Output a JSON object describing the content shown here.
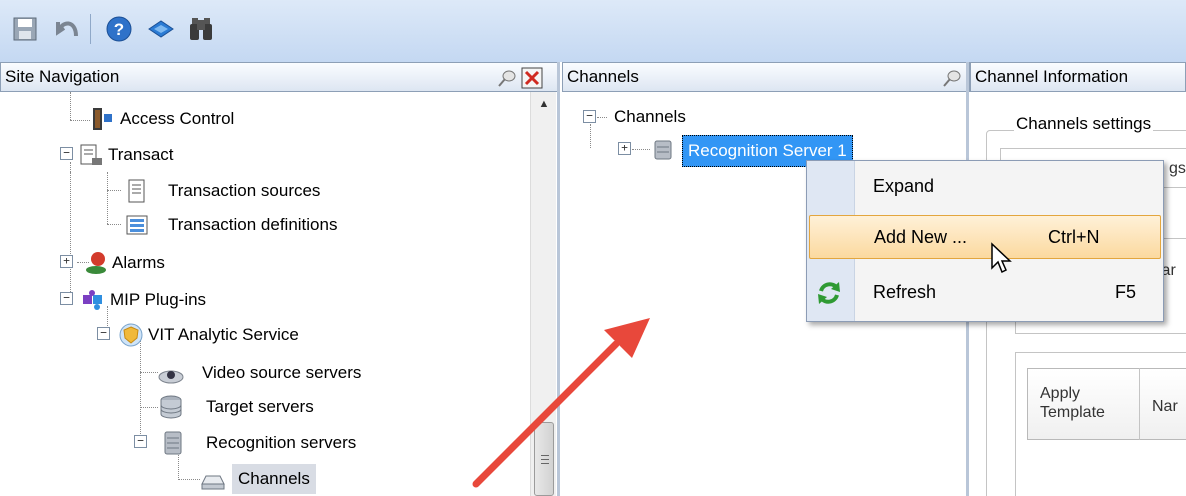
{
  "toolbar": {
    "icons": [
      "save-icon",
      "undo-icon",
      "help-icon",
      "layers-icon",
      "binoculars-icon"
    ]
  },
  "site_navigation": {
    "title": "Site Navigation",
    "items": [
      {
        "label": "Access Control",
        "icon": "access-control-icon"
      },
      {
        "label": "Transact",
        "icon": "transact-icon"
      },
      {
        "label": "Transaction sources",
        "icon": "transaction-source-icon"
      },
      {
        "label": "Transaction definitions",
        "icon": "transaction-definition-icon"
      },
      {
        "label": "Alarms",
        "icon": "alarm-icon"
      },
      {
        "label": "MIP Plug-ins",
        "icon": "puzzle-icon"
      },
      {
        "label": "VIT Analytic Service",
        "icon": "shield-icon"
      },
      {
        "label": "Video source servers",
        "icon": "camera-server-icon"
      },
      {
        "label": "Target servers",
        "icon": "database-icon"
      },
      {
        "label": "Recognition servers",
        "icon": "server-icon"
      },
      {
        "label": "Channels",
        "icon": "drive-icon"
      }
    ]
  },
  "channels_panel": {
    "title": "Channels",
    "root": "Channels",
    "child": "Recognition Server 1"
  },
  "context_menu": {
    "items": [
      {
        "label": "Expand",
        "shortcut": ""
      },
      {
        "label": "Add New ...",
        "shortcut": "Ctrl+N"
      },
      {
        "label": "Refresh",
        "shortcut": "F5"
      }
    ]
  },
  "channel_information": {
    "title": "Channel Information",
    "group_title": "Channels settings",
    "tab_fragment": "gs",
    "label_fragment": "lar",
    "grid_col1": "Apply Template",
    "grid_col2": "Nar"
  },
  "colors": {
    "selection": "#3296f5",
    "menu_hover": "#fbd99f",
    "arrow": "#e8483b"
  }
}
